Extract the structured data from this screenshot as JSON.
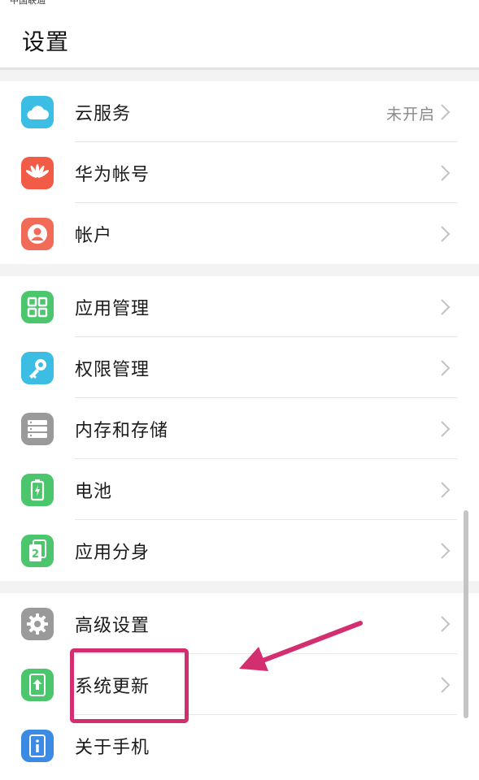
{
  "status_bar": {
    "carrier": "中国联通"
  },
  "header": {
    "title": "设置"
  },
  "groups": [
    {
      "items": [
        {
          "label": "云服务",
          "value": "未开启",
          "icon": "cloud-icon",
          "color": "#3bbde4"
        },
        {
          "label": "华为帐号",
          "value": "",
          "icon": "huawei-logo-icon",
          "color": "#f25c46"
        },
        {
          "label": "帐户",
          "value": "",
          "icon": "account-icon",
          "color": "#f26a58"
        }
      ]
    },
    {
      "items": [
        {
          "label": "应用管理",
          "value": "",
          "icon": "app-grid-icon",
          "color": "#4cc66c"
        },
        {
          "label": "权限管理",
          "value": "",
          "icon": "key-icon",
          "color": "#3bbde4"
        },
        {
          "label": "内存和存储",
          "value": "",
          "icon": "storage-icon",
          "color": "#9a9a9a"
        },
        {
          "label": "电池",
          "value": "",
          "icon": "battery-icon",
          "color": "#4cc66c"
        },
        {
          "label": "应用分身",
          "value": "",
          "icon": "app-twin-icon",
          "color": "#4cc66c"
        }
      ]
    },
    {
      "items": [
        {
          "label": "高级设置",
          "value": "",
          "icon": "gear-icon",
          "color": "#9a9a9a"
        },
        {
          "label": "系统更新",
          "value": "",
          "icon": "system-update-icon",
          "color": "#4cc66c"
        },
        {
          "label": "关于手机",
          "value": "",
          "icon": "info-icon",
          "color": "#3b8ae4"
        }
      ]
    }
  ],
  "colors": {
    "annotation": "#d22e70",
    "chevron": "#c2c2c2",
    "divider": "#e7e7e7"
  }
}
